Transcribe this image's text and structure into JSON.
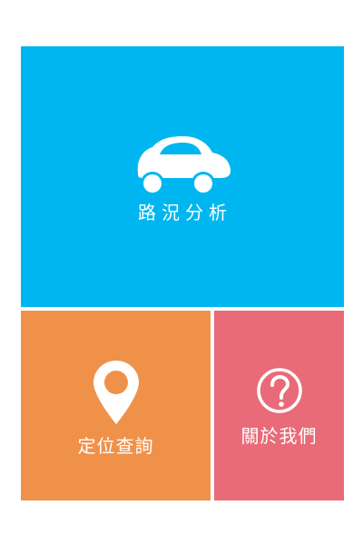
{
  "tiles": {
    "traffic": {
      "label": "路況分析",
      "icon": "car-icon",
      "color": "#00b6f0"
    },
    "location": {
      "label": "定位查詢",
      "icon": "map-pin-icon",
      "color": "#f0914a"
    },
    "about": {
      "label": "關於我們",
      "icon": "question-circle-icon",
      "color": "#e96a78"
    }
  }
}
